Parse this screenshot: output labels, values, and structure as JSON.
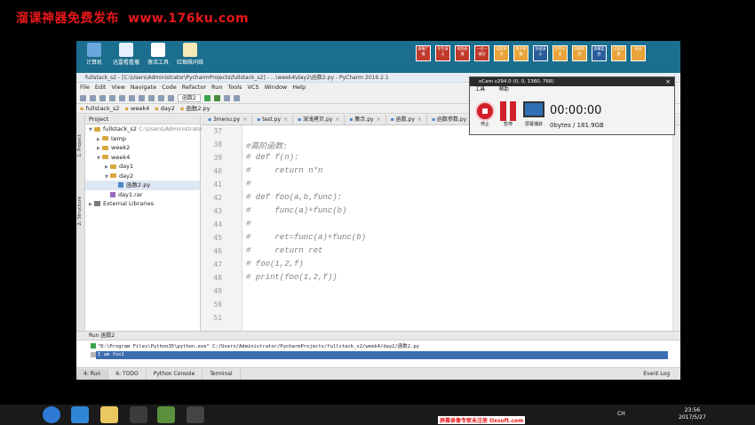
{
  "watermark": {
    "left": "溜课神器免费发布",
    "url": "www.176ku.com"
  },
  "desktop": {
    "icons": [
      {
        "label": "计算机",
        "color": "#6aa7dd"
      },
      {
        "label": "迅雷看看播",
        "color": "#e6f0ff"
      },
      {
        "label": "激活工具",
        "color": "#ffffff"
      },
      {
        "label": "红蜘蛛同络",
        "color": "#f5e9b8"
      }
    ],
    "tools": [
      "屏幕广播",
      "学生演示",
      "视频直播",
      "一对一辅导",
      "远程命令",
      "电子教鞭",
      "快速演示",
      "文件分发",
      "网络影院",
      "屏幕监控",
      "远程设置",
      "退出"
    ]
  },
  "pycharm": {
    "title": "fullstack_s2 - [C:\\Users\\Administrator\\PycharmProjects\\fullstack_s2] - ...\\week4\\day2\\函数2.py - PyCharm 2016.2.1",
    "menu": [
      "File",
      "Edit",
      "View",
      "Navigate",
      "Code",
      "Refactor",
      "Run",
      "Tools",
      "VCS",
      "Window",
      "Help"
    ],
    "run_config": "函数2",
    "breadcrumbs": [
      "fullstack_s2",
      "week4",
      "day2",
      "函数2.py"
    ],
    "project_header": "Project",
    "side_tabs": [
      "1: Project",
      "2: Structure",
      "2: Favorites"
    ],
    "tree": [
      {
        "label": "fullstack_s2",
        "extra": "C:\\Users\\Administrator\\...",
        "indent": 0,
        "kind": "folder",
        "arrow": "▼"
      },
      {
        "label": "temp",
        "indent": 1,
        "kind": "folder",
        "arrow": "▶"
      },
      {
        "label": "week2",
        "indent": 1,
        "kind": "folder",
        "arrow": "▶"
      },
      {
        "label": "week4",
        "indent": 1,
        "kind": "folder",
        "arrow": "▼"
      },
      {
        "label": "day1",
        "indent": 2,
        "kind": "folder",
        "arrow": "▶"
      },
      {
        "label": "day2",
        "indent": 2,
        "kind": "folder",
        "arrow": "▼"
      },
      {
        "label": "函数2.py",
        "indent": 3,
        "kind": "py",
        "arrow": ""
      },
      {
        "label": "day1.rar",
        "indent": 2,
        "kind": "rar",
        "arrow": ""
      },
      {
        "label": "External Libraries",
        "indent": 0,
        "kind": "lib",
        "arrow": "▶"
      }
    ],
    "tabs": [
      "3menu.py",
      "test.py",
      "深浅拷贝.py",
      "集合.py",
      "函数.py",
      "函数参数.py",
      "函数2.py"
    ],
    "code_lines": [
      {
        "n": "37",
        "t": ""
      },
      {
        "n": "38",
        "t": "#高阶函数:"
      },
      {
        "n": "39",
        "t": "# def f(n):"
      },
      {
        "n": "40",
        "t": "#     return n*n"
      },
      {
        "n": "41",
        "t": "#"
      },
      {
        "n": "42",
        "t": "# def foo(a,b,func):"
      },
      {
        "n": "43",
        "t": "#     func(a)+func(b)"
      },
      {
        "n": "44",
        "t": "#"
      },
      {
        "n": "45",
        "t": "#     ret=func(a)+func(b)"
      },
      {
        "n": "46",
        "t": "#     return ret"
      },
      {
        "n": "47",
        "t": "# foo(1,2,f)"
      },
      {
        "n": "48",
        "t": "# print(foo(1,2,f))"
      },
      {
        "n": "49",
        "t": ""
      },
      {
        "n": "50",
        "t": ""
      },
      {
        "n": "51",
        "t": ""
      }
    ],
    "run": {
      "header": "Run  函数2",
      "line1": "\"D:\\Program Files\\Python35\\python.exe\" C:/Users/Administrator/PycharmProjects/fullstack_s2/week4/day2/函数2.py",
      "line2": "I am foo1"
    },
    "bottom_tabs": [
      "4: Run",
      "6: TODO",
      "Python Console",
      "Terminal"
    ],
    "event_log": "Event Log"
  },
  "ocam": {
    "title": "oCam v294.0 (0, 0, 1360, 768)",
    "menu": [
      "工具",
      "帮助"
    ],
    "stop": "停止",
    "pause": "暂停",
    "screen": "屏幕捕获",
    "time": "00:00:00",
    "size": "0bytes / 181.9GB"
  },
  "taskbar": {
    "apps": [
      {
        "name": "start",
        "color": "#2f7ad4"
      },
      {
        "name": "ie",
        "color": "#2f86d6"
      },
      {
        "name": "explorer",
        "color": "#e9c860"
      },
      {
        "name": "media",
        "color": "#3b3b3b"
      },
      {
        "name": "pycharm",
        "color": "#5a8f3d"
      },
      {
        "name": "ocam",
        "color": "#444444"
      }
    ],
    "banner": "屏幕录像专家未注册 tlxsoft.com",
    "tray": "CH",
    "time": "23:56",
    "date": "2017/5/27"
  }
}
